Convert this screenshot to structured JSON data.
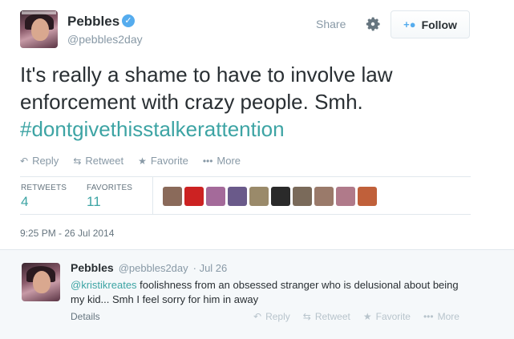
{
  "tweet": {
    "name": "Pebbles",
    "verified_icon": "verified-badge-icon",
    "handle": "@pebbles2day",
    "share_label": "Share",
    "follow_label": "Follow",
    "text_plain": "It's really a shame to have to involve law enforcement with crazy people. Smh.",
    "hashtag": "#dontgivethisstalkerattention",
    "actions": {
      "reply": "Reply",
      "retweet": "Retweet",
      "favorite": "Favorite",
      "more": "More"
    },
    "stats": {
      "retweets_label": "RETWEETS",
      "retweets_value": "4",
      "favorites_label": "FAVORITES",
      "favorites_value": "11"
    },
    "favoriter_avatar_colors": [
      "#8a6a5a",
      "#cc2222",
      "#a46a9a",
      "#6a5a8a",
      "#9a8a6a",
      "#2a2a2a",
      "#7a6a5a",
      "#9a7a6a",
      "#b07a8a",
      "#c0603a"
    ],
    "timestamp": "9:25 PM - 26 Jul 2014"
  },
  "reply": {
    "name": "Pebbles",
    "handle": "@pebbles2day",
    "date": "· Jul 26",
    "mention": "@kristikreates",
    "text": " foolishness from an obsessed stranger who is delusional about being my kid... Smh I feel sorry for him in away",
    "details_label": "Details",
    "actions": {
      "reply": "Reply",
      "retweet": "Retweet",
      "favorite": "Favorite",
      "more": "More"
    }
  },
  "colors": {
    "accent_teal": "#3da4a4",
    "twitter_blue": "#55acee",
    "muted_gray": "#8899a6"
  }
}
